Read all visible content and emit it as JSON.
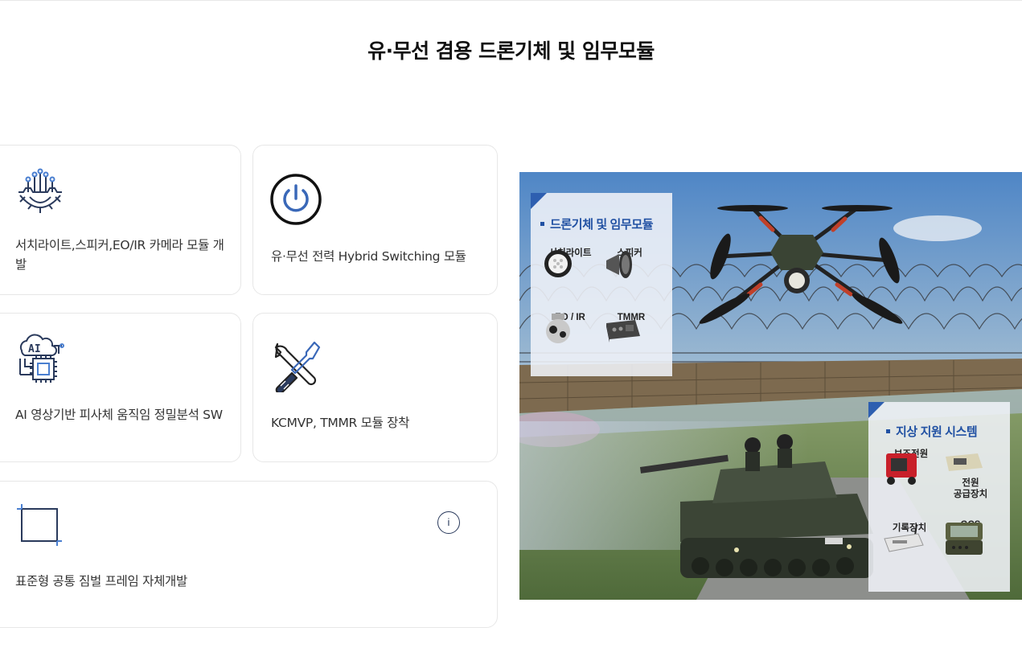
{
  "page": {
    "title": "유·무선 겸용 드론기체 및 임무모듈"
  },
  "cards": [
    {
      "icon": "circuit-gear-icon",
      "label": "서치라이트,스피커,EO/IR 카메라 모듈 개발"
    },
    {
      "icon": "power-icon",
      "label": "유·무선 전력 Hybrid Switching 모듈"
    },
    {
      "icon": "ai-chip-icon",
      "label": "AI 영상기반 피사체 움직임 정밀분석 SW"
    },
    {
      "icon": "wrench-screwdriver-icon",
      "label": "KCMVP, TMMR 모듈 장착"
    },
    {
      "icon": "crop-frame-icon",
      "label": "표준형 공통 짐벌 프레임 자체개발",
      "info_button": "i"
    }
  ],
  "illustration": {
    "drone_panel": {
      "title": "드론기체 및 임무모듈",
      "items": [
        "서치라이트",
        "스피커",
        "EO / IR",
        "TMMR"
      ]
    },
    "ground_panel": {
      "title": "지상 지원 시스템",
      "items": [
        "보조전원",
        "전원\n공급장치",
        "기록장치",
        "GCS"
      ]
    }
  },
  "colors": {
    "accent": "#2151a3",
    "title_highlight": "#a7c2e6",
    "icon_navy": "#2a3a5c"
  }
}
